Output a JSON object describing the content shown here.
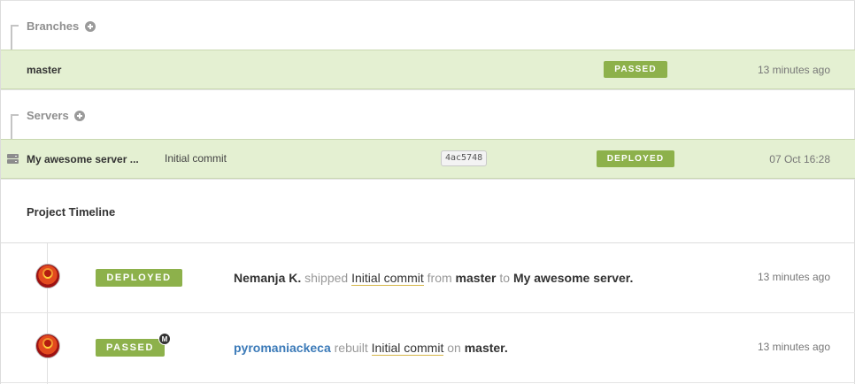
{
  "branches": {
    "title": "Branches",
    "items": [
      {
        "name": "master",
        "status": "PASSED",
        "time": "13 minutes ago"
      }
    ]
  },
  "servers": {
    "title": "Servers",
    "items": [
      {
        "name": "My awesome server ...",
        "commit_message": "Initial commit",
        "sha": "4ac5748",
        "status": "DEPLOYED",
        "time": "07 Oct 16:28"
      }
    ]
  },
  "timeline": {
    "title": "Project Timeline",
    "events": [
      {
        "status": "DEPLOYED",
        "actor": "Nemanja K.",
        "verb": "shipped",
        "commit": "Initial commit",
        "prep1": "from",
        "branch": "master",
        "prep2": "to",
        "target": "My awesome server",
        "end": ".",
        "time": "13 minutes ago"
      },
      {
        "status": "PASSED",
        "marker": "M",
        "actor": "pyromaniackeca",
        "verb": "rebuilt",
        "commit": "Initial commit",
        "prep1": "on",
        "branch": "master",
        "end": ".",
        "time": "13 minutes ago"
      }
    ]
  },
  "icons": {
    "add": "plus-circle-icon",
    "server": "server-icon",
    "avatar": "avatar-icon"
  },
  "colors": {
    "success_green": "#8db14b",
    "row_highlight": "#e4f0d2",
    "link_blue": "#3b7ab8"
  }
}
